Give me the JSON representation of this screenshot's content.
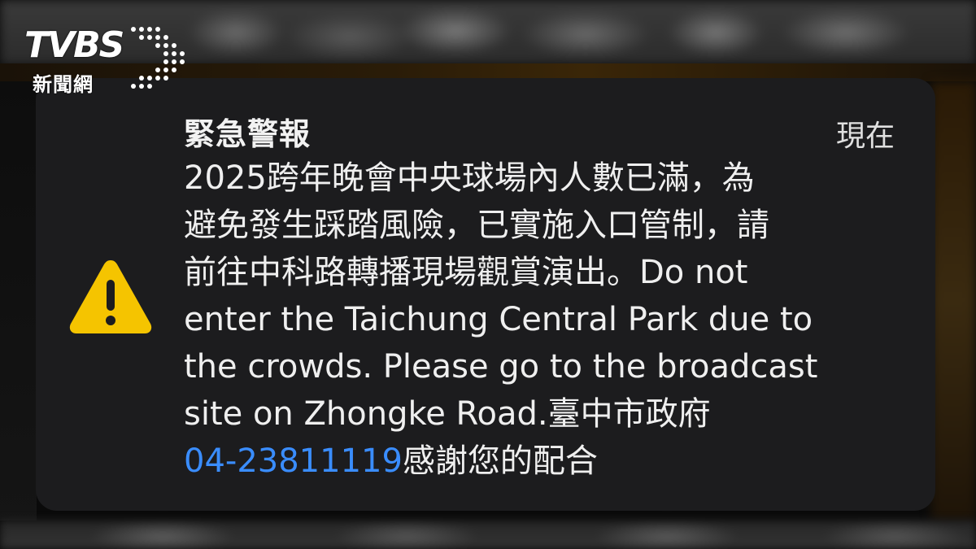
{
  "logo": {
    "brand": "TVBS",
    "subtitle": "新聞網"
  },
  "notification": {
    "title": "緊急警報",
    "time": "現在",
    "icon": "warning-triangle-icon",
    "icon_color": "#f5c400",
    "body_lines": [
      "2025跨年晚會中央球場內人數已滿，為",
      "避免發生踩踏風險，已實施入口管制，請",
      "前往中科路轉播現場觀賞演出。Do not",
      "enter the Taichung Central Park due to",
      "the crowds. Please go to the broadcast",
      "site on Zhongke Road.臺中市政府"
    ],
    "phone": "04-23811119",
    "closing": "感謝您的配合",
    "link_color": "#3a8dff"
  }
}
